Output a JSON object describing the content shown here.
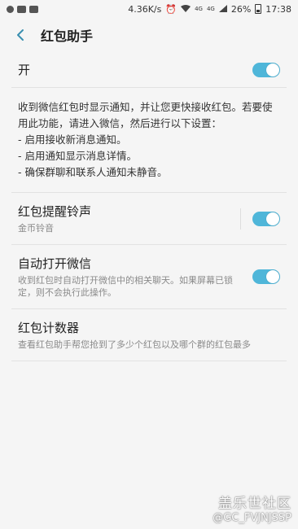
{
  "status_bar": {
    "net_speed": "4.36K/s",
    "signal1": "4G",
    "signal2": "4G",
    "battery": "26%",
    "time": "17:38"
  },
  "appbar": {
    "title": "红包助手"
  },
  "master": {
    "label": "开",
    "on": true
  },
  "description": [
    "收到微信红包时显示通知，并让您更快接收红包。若要使用此功能，请进入微信，然后进行以下设置：",
    "- 启用接收新消息通知。",
    "- 启用通知显示消息详情。",
    "- 确保群聊和联系人通知未静音。"
  ],
  "items": [
    {
      "title": "红包提醒铃声",
      "subtitle": "金币铃音",
      "toggle": true
    },
    {
      "title": "自动打开微信",
      "subtitle": "收到红包时自动打开微信中的相关聊天。如果屏幕已锁定，则不会执行此操作。",
      "toggle": true
    },
    {
      "title": "红包计数器",
      "subtitle": "查看红包助手帮您抢到了多少个红包以及哪个群的红包最多"
    }
  ],
  "watermark": {
    "line1": "盖乐世社区",
    "line2": "@GC_FVJNJSSP"
  },
  "colors": {
    "accent": "#4fb6d9",
    "background": "#f5f5f5"
  }
}
